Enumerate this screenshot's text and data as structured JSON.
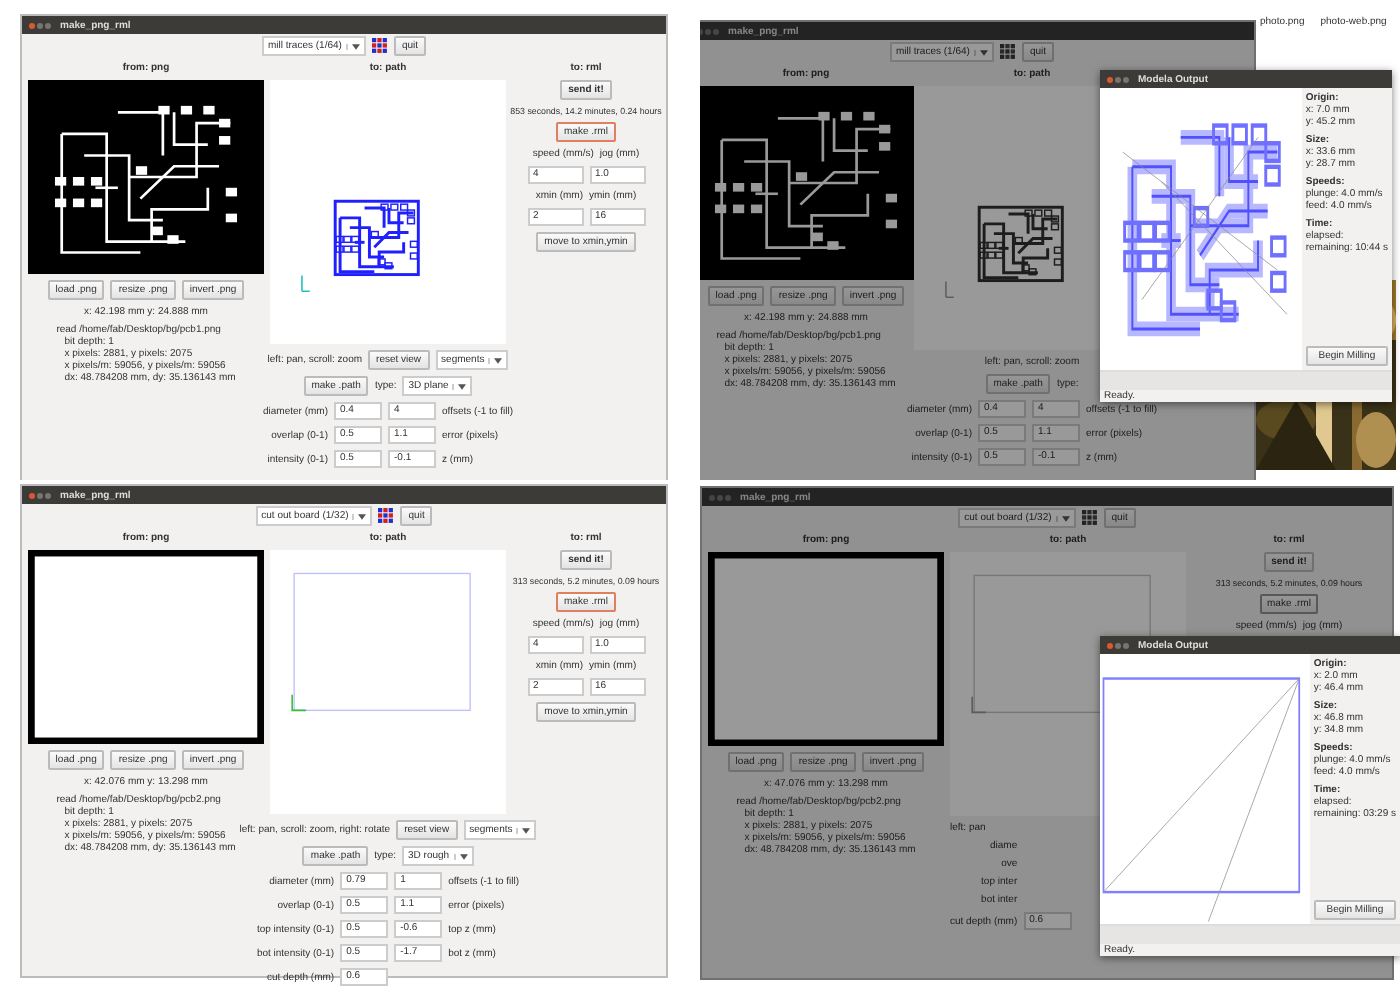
{
  "panels": [
    {
      "title": "make_png_rml",
      "dimmed": false,
      "mode": "mill traces (1/64)",
      "quit": "quit",
      "from": {
        "heading": "from: png",
        "image": {
          "kind": "traces"
        },
        "buttons": [
          "load .png",
          "resize .png",
          "invert .png"
        ],
        "coords": "x: 42.198 mm  y: 24.888 mm",
        "info": [
          "read /home/fab/Desktop/bg/pcb1.png",
          "bit depth: 1",
          "x pixels: 2881, y pixels: 2075",
          "x pixels/m: 59056, y pixels/m: 59056",
          "dx: 48.784208 mm, dy: 35.136143 mm"
        ]
      },
      "path": {
        "heading": "to: path",
        "view": {
          "kind": "traces"
        },
        "hint": "left: pan, scroll: zoom",
        "reset": "reset view",
        "segments": "segments",
        "make": "make .path",
        "type_label": "type:",
        "type": "3D plane",
        "rows": [
          {
            "label": "diameter (mm)",
            "a": "0.4",
            "b": "4",
            "note": "offsets (-1 to fill)"
          },
          {
            "label": "overlap (0-1)",
            "a": "0.5",
            "b": "1.1",
            "note": "error (pixels)"
          },
          {
            "label": "intensity (0-1)",
            "a": "0.5",
            "b": "-0.1",
            "note": "z (mm)"
          }
        ]
      },
      "rml": {
        "heading": "to: rml",
        "send": "send it!",
        "time": "853 seconds, 14.2 minutes, 0.24 hours",
        "make": "make .rml",
        "labels": [
          "speed (mm/s)",
          "jog (mm)"
        ],
        "values": [
          "4",
          "1.0"
        ],
        "labels2": [
          "xmin (mm)",
          "ymin (mm)"
        ],
        "values2": [
          "2",
          "16"
        ],
        "move": "move to xmin,ymin"
      }
    },
    {
      "title": "make_png_rml",
      "dimmed": true,
      "mode": "mill traces (1/64)",
      "quit": "quit",
      "desktop": {
        "files": [
          "photo.png",
          "photo-web.png"
        ],
        "picture": {
          "kind": "picture"
        }
      },
      "from": {
        "heading": "from: png",
        "image": {
          "kind": "traces"
        },
        "buttons": [
          "load .png",
          "resize .png",
          "invert .png"
        ],
        "coords": "x: 42.198 mm  y: 24.888 mm",
        "info": [
          "read /home/fab/Desktop/bg/pcb1.png",
          "bit depth: 1",
          "x pixels: 2881, y pixels: 2075",
          "x pixels/m: 59056, y pixels/m: 59056",
          "dx: 48.784208 mm, dy: 35.136143 mm"
        ]
      },
      "path": {
        "heading": "to: path",
        "view": {
          "kind": "traces"
        },
        "hint": "left: pan, scroll: zoom",
        "make": "make .path",
        "type_label": "type:",
        "rows": [
          {
            "label": "diameter (mm)",
            "a": "0.4",
            "b": "4",
            "note": "offsets (-1 to fill)"
          },
          {
            "label": "overlap (0-1)",
            "a": "0.5",
            "b": "1.1",
            "note": "error (pixels)"
          },
          {
            "label": "intensity (0-1)",
            "a": "0.5",
            "b": "-0.1",
            "note": "z (mm)"
          }
        ]
      },
      "dialog": {
        "title": "Modela Output",
        "plot": {
          "kind": "traces"
        },
        "sections": [
          {
            "heading": "Origin:",
            "lines": [
              "x: 7.0 mm",
              "y: 45.2 mm"
            ]
          },
          {
            "heading": "Size:",
            "lines": [
              "x: 33.6 mm",
              "y: 28.7 mm"
            ]
          },
          {
            "heading": "Speeds:",
            "lines": [
              "plunge: 4.0 mm/s",
              "feed: 4.0 mm/s"
            ]
          },
          {
            "heading": "Time:",
            "lines": [
              "elapsed:",
              "remaining: 10:44 s"
            ]
          }
        ],
        "button": "Begin Milling",
        "status": "Ready."
      }
    },
    {
      "title": "make_png_rml",
      "dimmed": false,
      "mode": "cut out board (1/32)",
      "quit": "quit",
      "from": {
        "heading": "from: png",
        "image": {
          "kind": "outline"
        },
        "buttons": [
          "load .png",
          "resize .png",
          "invert .png"
        ],
        "coords": "x: 42.076 mm  y: 13.298 mm",
        "info": [
          "read /home/fab/Desktop/bg/pcb2.png",
          "bit depth: 1",
          "x pixels: 2881, y pixels: 2075",
          "x pixels/m: 59056, y pixels/m: 59056",
          "dx: 48.784208 mm, dy: 35.136143 mm"
        ]
      },
      "path": {
        "heading": "to: path",
        "view": {
          "kind": "outline"
        },
        "hint": "left: pan, scroll: zoom, right: rotate",
        "reset": "reset view",
        "segments": "segments",
        "make": "make .path",
        "type_label": "type:",
        "type": "3D rough",
        "rows": [
          {
            "label": "diameter (mm)",
            "a": "0.79",
            "b": "1",
            "note": "offsets (-1 to fill)"
          },
          {
            "label": "overlap (0-1)",
            "a": "0.5",
            "b": "1.1",
            "note": "error (pixels)"
          },
          {
            "label": "top intensity (0-1)",
            "a": "0.5",
            "b": "-0.6",
            "note": "top z (mm)"
          },
          {
            "label": "bot intensity (0-1)",
            "a": "0.5",
            "b": "-1.7",
            "note": "bot z (mm)"
          },
          {
            "label": "cut depth (mm)",
            "a": "0.6"
          }
        ]
      },
      "rml": {
        "heading": "to: rml",
        "send": "send it!",
        "time": "313 seconds, 5.2 minutes, 0.09 hours",
        "make": "make .rml",
        "labels": [
          "speed (mm/s)",
          "jog (mm)"
        ],
        "values": [
          "4",
          "1.0"
        ],
        "labels2": [
          "xmin (mm)",
          "ymin (mm)"
        ],
        "values2": [
          "2",
          "16"
        ],
        "move": "move to xmin,ymin"
      }
    },
    {
      "title": "make_png_rml",
      "dimmed": true,
      "mode": "cut out board (1/32)",
      "quit": "quit",
      "from": {
        "heading": "from: png",
        "image": {
          "kind": "outline"
        },
        "buttons": [
          "load .png",
          "resize .png",
          "invert .png"
        ],
        "coords": "x: 47.076 mm  y: 13.298 mm",
        "info": [
          "read /home/fab/Desktop/bg/pcb2.png",
          "bit depth: 1",
          "x pixels: 2881, y pixels: 2075",
          "x pixels/m: 59056, y pixels/m: 59056",
          "dx: 48.784208 mm, dy: 35.136143 mm"
        ]
      },
      "path": {
        "heading": "to: path",
        "view": {
          "kind": "outline"
        },
        "hint": "left: pan",
        "rows": [
          {
            "label": "diame"
          },
          {
            "label": "ove"
          },
          {
            "label": "top inter"
          },
          {
            "label": "bot inter"
          },
          {
            "label": "cut depth (mm)",
            "a": "0.6"
          }
        ]
      },
      "rml": {
        "heading": "to: rml",
        "send": "send it!",
        "time": "313 seconds, 5.2 minutes, 0.09 hours",
        "make": "make .rml",
        "labels": [
          "speed (mm/s)",
          "jog (mm)"
        ]
      },
      "dialog": {
        "title": "Modela Output",
        "plot": {
          "kind": "outline"
        },
        "sections": [
          {
            "heading": "Origin:",
            "lines": [
              "x: 2.0 mm",
              "y: 46.4 mm"
            ]
          },
          {
            "heading": "Size:",
            "lines": [
              "x: 46.8 mm",
              "y: 34.8 mm"
            ]
          },
          {
            "heading": "Speeds:",
            "lines": [
              "plunge: 4.0 mm/s",
              "feed: 4.0 mm/s"
            ]
          },
          {
            "heading": "Time:",
            "lines": [
              "elapsed:",
              "remaining: 03:29 s"
            ]
          }
        ],
        "button": "Begin Milling",
        "status": "Ready."
      }
    }
  ]
}
